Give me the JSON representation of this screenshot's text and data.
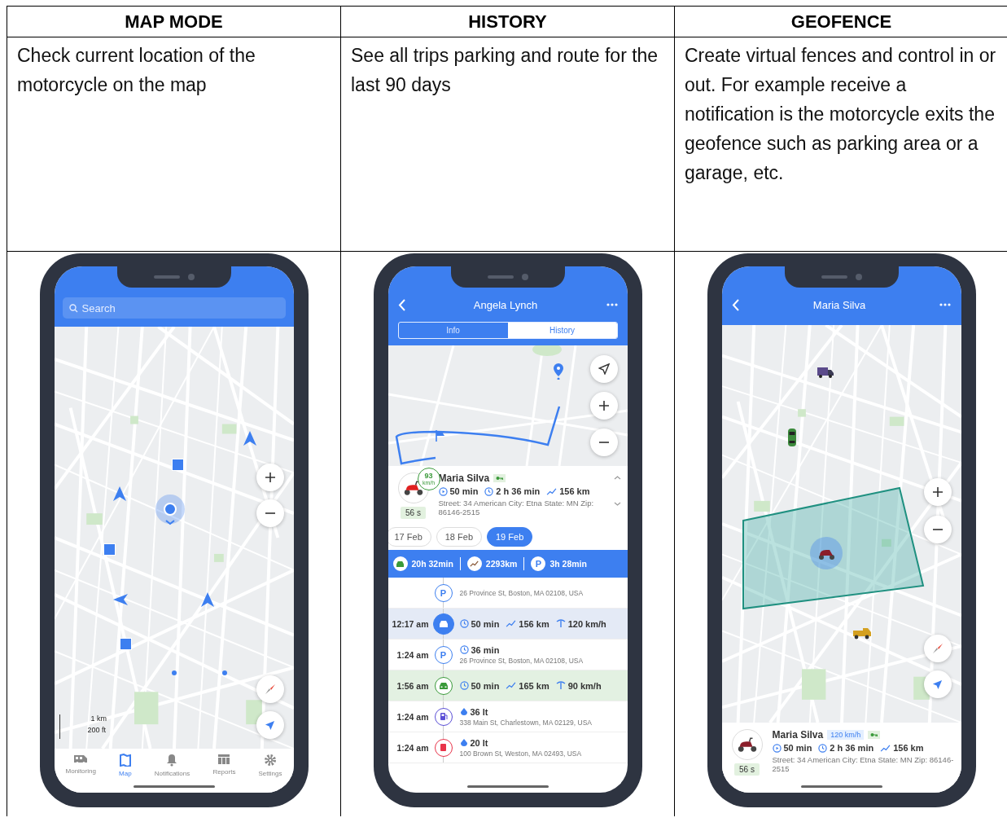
{
  "columns": [
    {
      "heading": "MAP MODE",
      "description": "Check current location of the motorcycle on the map",
      "screen": {
        "kind": "map",
        "search": {
          "placeholder": "Search"
        },
        "scale": [
          "1 km",
          "200 ft"
        ],
        "tabs": [
          {
            "label": "Monitoring",
            "selected": false
          },
          {
            "label": "Map",
            "selected": true
          },
          {
            "label": "Notifications",
            "selected": false
          },
          {
            "label": "Reports",
            "selected": false
          },
          {
            "label": "Settings",
            "selected": false
          }
        ]
      }
    },
    {
      "heading": "HISTORY",
      "description": "See all trips parking and route for the last 90 days",
      "screen": {
        "kind": "history",
        "title": "Angela Lynch",
        "segments": [
          {
            "label": "Info",
            "selected": false
          },
          {
            "label": "History",
            "selected": true
          }
        ],
        "vehicle": {
          "name": "Maria Silva",
          "speed_value": "93",
          "speed_unit": "km/h",
          "idle": "56 s",
          "stats": [
            "50 min",
            "2 h 36 min",
            "156 km"
          ],
          "address": "Street: 34 American City: Etna State: MN Zip: 86146-2515"
        },
        "dates": [
          {
            "label": "17 Feb",
            "selected": false
          },
          {
            "label": "18 Feb",
            "selected": false
          },
          {
            "label": "19 Feb",
            "selected": true
          }
        ],
        "summary": [
          {
            "kind": "drive",
            "text": "20h 32min"
          },
          {
            "kind": "distance",
            "text": "2293km"
          },
          {
            "kind": "parking",
            "badge": "P",
            "text": "3h 28min"
          }
        ],
        "timeline": [
          {
            "kind": "parking",
            "badge": "P",
            "selected": false,
            "address": "26 Province St, Boston, MA 02108, USA"
          },
          {
            "kind": "drive",
            "selected": true,
            "time": "12:17 am",
            "stats": [
              "50 min",
              "156 km",
              "120 km/h"
            ]
          },
          {
            "kind": "parking",
            "badge": "P",
            "selected": false,
            "time": "1:24 am",
            "stats": [
              "36 min"
            ],
            "address": "26 Province St, Boston, MA 02108, USA"
          },
          {
            "kind": "drive",
            "selected": false,
            "time": "1:56 am",
            "stats": [
              "50 min",
              "165 km",
              "90 km/h"
            ]
          },
          {
            "kind": "fuel",
            "selected": false,
            "time": "1:24 am",
            "stats": [
              "36 lt"
            ],
            "address": "338 Main St, Charlestown, MA 02129, USA"
          },
          {
            "kind": "drain",
            "selected": false,
            "time": "1:24 am",
            "stats": [
              "20 lt"
            ],
            "address": "100 Brown St, Weston, MA 02493, USA"
          }
        ]
      }
    },
    {
      "heading": "GEOFENCE",
      "description": "Create virtual fences and control in or out. For example receive a notification is the motorcycle exits the geofence such as parking area or a garage, etc.",
      "screen": {
        "kind": "geofence",
        "title": "Maria Silva",
        "vehicle": {
          "name": "Maria Silva",
          "speed": "120 km/h",
          "idle": "56 s",
          "stats": [
            "50 min",
            "2 h 36 min",
            "156 km"
          ],
          "address": "Street: 34 American City: Etna State: MN Zip: 86146-2515"
        }
      }
    }
  ]
}
